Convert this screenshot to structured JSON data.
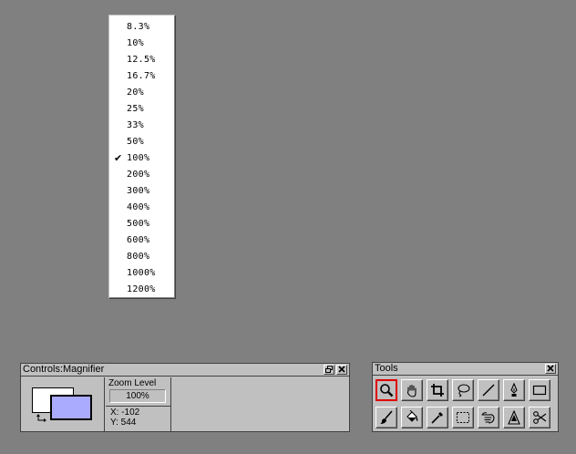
{
  "zoom_menu": {
    "items": [
      "8.3%",
      "10%",
      "12.5%",
      "16.7%",
      "20%",
      "25%",
      "33%",
      "50%",
      "100%",
      "200%",
      "300%",
      "400%",
      "500%",
      "600%",
      "800%",
      "1000%",
      "1200%"
    ],
    "checked": "100%",
    "check_glyph": "✔"
  },
  "controls": {
    "title": "Controls:Magnifier",
    "restore_glyph": "🗗",
    "close_glyph": "✕",
    "zoom_level_label": "Zoom Level",
    "zoom_level_value": "100%",
    "x_readout": "X: -102",
    "y_readout": "Y: 544",
    "foreground_color": "#ffffff",
    "background_color": "#aaaaff"
  },
  "tools": {
    "title": "Tools",
    "close_glyph": "✕",
    "active_tool": "magnifier-tool",
    "items": [
      "magnifier-icon",
      "hand-icon",
      "crop-icon",
      "lasso-icon",
      "line-icon",
      "pen-icon",
      "rectangle-icon",
      "brush-icon",
      "fill-bucket-icon",
      "eyedropper-icon",
      "marquee-icon",
      "pan-hand-icon",
      "text-icon",
      "scissors-icon"
    ]
  },
  "colors": {
    "desktop": "#808080",
    "panel": "#c0c0c0",
    "active_tool_border": "#e00000"
  }
}
